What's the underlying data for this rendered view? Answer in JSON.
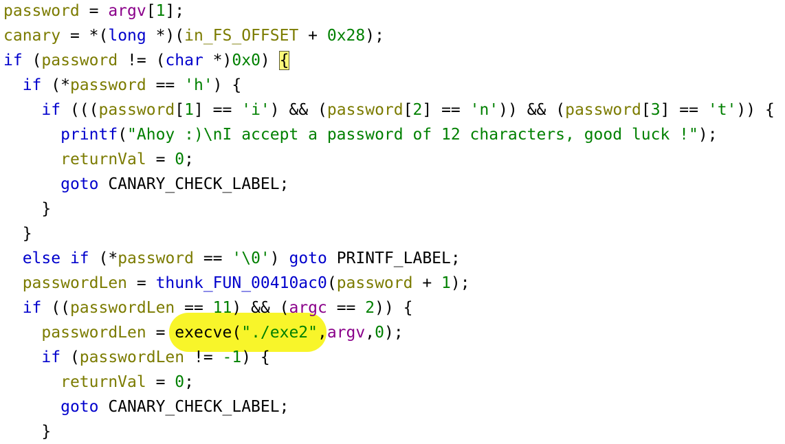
{
  "colors": {
    "variable": "#7b7b00",
    "keyword": "#0000cc",
    "number": "#008000",
    "string": "#008000",
    "type": "#0000cc",
    "function": "#0000cc",
    "parameter": "#8a008a",
    "plain": "#000000",
    "highlight": "#f8f52a",
    "brace_box": "#fbf97a"
  },
  "code": {
    "lines": [
      [
        {
          "t": "password",
          "c": "var"
        },
        {
          "t": " = ",
          "c": "plain"
        },
        {
          "t": "argv",
          "c": "param"
        },
        {
          "t": "[",
          "c": "plain"
        },
        {
          "t": "1",
          "c": "num"
        },
        {
          "t": "];",
          "c": "plain"
        }
      ],
      [
        {
          "t": "canary",
          "c": "var"
        },
        {
          "t": " = *(",
          "c": "plain"
        },
        {
          "t": "long",
          "c": "type"
        },
        {
          "t": " *)(",
          "c": "plain"
        },
        {
          "t": "in_FS_OFFSET",
          "c": "var"
        },
        {
          "t": " + ",
          "c": "plain"
        },
        {
          "t": "0x28",
          "c": "num"
        },
        {
          "t": ");",
          "c": "plain"
        }
      ],
      [
        {
          "t": "if",
          "c": "kw"
        },
        {
          "t": " (",
          "c": "plain"
        },
        {
          "t": "password",
          "c": "var"
        },
        {
          "t": " != (",
          "c": "plain"
        },
        {
          "t": "char",
          "c": "type"
        },
        {
          "t": " *)",
          "c": "plain"
        },
        {
          "t": "0x0",
          "c": "num"
        },
        {
          "t": ") ",
          "c": "plain"
        },
        {
          "t": "{",
          "c": "brace"
        }
      ],
      [
        {
          "t": "  ",
          "c": "plain"
        },
        {
          "t": "if",
          "c": "kw"
        },
        {
          "t": " (*",
          "c": "plain"
        },
        {
          "t": "password",
          "c": "var"
        },
        {
          "t": " == ",
          "c": "plain"
        },
        {
          "t": "'h'",
          "c": "str"
        },
        {
          "t": ") {",
          "c": "plain"
        }
      ],
      [
        {
          "t": "    ",
          "c": "plain"
        },
        {
          "t": "if",
          "c": "kw"
        },
        {
          "t": " (((",
          "c": "plain"
        },
        {
          "t": "password",
          "c": "var"
        },
        {
          "t": "[",
          "c": "plain"
        },
        {
          "t": "1",
          "c": "num"
        },
        {
          "t": "] == ",
          "c": "plain"
        },
        {
          "t": "'i'",
          "c": "str"
        },
        {
          "t": ") && (",
          "c": "plain"
        },
        {
          "t": "password",
          "c": "var"
        },
        {
          "t": "[",
          "c": "plain"
        },
        {
          "t": "2",
          "c": "num"
        },
        {
          "t": "] == ",
          "c": "plain"
        },
        {
          "t": "'n'",
          "c": "str"
        },
        {
          "t": ")) && (",
          "c": "plain"
        },
        {
          "t": "password",
          "c": "var"
        },
        {
          "t": "[",
          "c": "plain"
        },
        {
          "t": "3",
          "c": "num"
        },
        {
          "t": "] == ",
          "c": "plain"
        },
        {
          "t": "'t'",
          "c": "str"
        },
        {
          "t": ")) {",
          "c": "plain"
        }
      ],
      [
        {
          "t": "      ",
          "c": "plain"
        },
        {
          "t": "printf",
          "c": "fn"
        },
        {
          "t": "(",
          "c": "plain"
        },
        {
          "t": "\"Ahoy :)\\nI accept a password of 12 characters, good luck !\"",
          "c": "str"
        },
        {
          "t": ");",
          "c": "plain"
        }
      ],
      [
        {
          "t": "      ",
          "c": "plain"
        },
        {
          "t": "returnVal",
          "c": "var"
        },
        {
          "t": " = ",
          "c": "plain"
        },
        {
          "t": "0",
          "c": "num"
        },
        {
          "t": ";",
          "c": "plain"
        }
      ],
      [
        {
          "t": "      ",
          "c": "plain"
        },
        {
          "t": "goto",
          "c": "kw"
        },
        {
          "t": " CANARY_CHECK_LABEL;",
          "c": "plain"
        }
      ],
      [
        {
          "t": "    }",
          "c": "plain"
        }
      ],
      [
        {
          "t": "  }",
          "c": "plain"
        }
      ],
      [
        {
          "t": "  ",
          "c": "plain"
        },
        {
          "t": "else",
          "c": "kw"
        },
        {
          "t": " ",
          "c": "plain"
        },
        {
          "t": "if",
          "c": "kw"
        },
        {
          "t": " (*",
          "c": "plain"
        },
        {
          "t": "password",
          "c": "var"
        },
        {
          "t": " == ",
          "c": "plain"
        },
        {
          "t": "'\\0'",
          "c": "str"
        },
        {
          "t": ") ",
          "c": "plain"
        },
        {
          "t": "goto",
          "c": "kw"
        },
        {
          "t": " PRINTF_LABEL;",
          "c": "plain"
        }
      ],
      [
        {
          "t": "  ",
          "c": "plain"
        },
        {
          "t": "passwordLen",
          "c": "var"
        },
        {
          "t": " = ",
          "c": "plain"
        },
        {
          "t": "thunk_FUN_00410ac0",
          "c": "fn"
        },
        {
          "t": "(",
          "c": "plain"
        },
        {
          "t": "password",
          "c": "var"
        },
        {
          "t": " + ",
          "c": "plain"
        },
        {
          "t": "1",
          "c": "num"
        },
        {
          "t": ");",
          "c": "plain"
        }
      ],
      [
        {
          "t": "  ",
          "c": "plain"
        },
        {
          "t": "if",
          "c": "kw"
        },
        {
          "t": " ((",
          "c": "plain"
        },
        {
          "t": "passwordLen",
          "c": "var"
        },
        {
          "t": " == ",
          "c": "plain"
        },
        {
          "t": "11",
          "c": "num"
        },
        {
          "t": ") && (",
          "c": "plain"
        },
        {
          "t": "argc",
          "c": "param"
        },
        {
          "t": " == ",
          "c": "plain"
        },
        {
          "t": "2",
          "c": "num"
        },
        {
          "t": ")) {",
          "c": "plain"
        }
      ],
      [
        {
          "t": "    ",
          "c": "plain"
        },
        {
          "t": "passwordLen",
          "c": "var"
        },
        {
          "t": " = ",
          "c": "plain"
        },
        {
          "t": "execve",
          "c": "plain"
        },
        {
          "t": "(",
          "c": "plain"
        },
        {
          "t": "\"./exe2\"",
          "c": "str"
        },
        {
          "t": ",",
          "c": "plain"
        },
        {
          "t": "argv",
          "c": "param"
        },
        {
          "t": ",",
          "c": "plain"
        },
        {
          "t": "0",
          "c": "num"
        },
        {
          "t": ");",
          "c": "plain"
        }
      ],
      [
        {
          "t": "    ",
          "c": "plain"
        },
        {
          "t": "if",
          "c": "kw"
        },
        {
          "t": " (",
          "c": "plain"
        },
        {
          "t": "passwordLen",
          "c": "var"
        },
        {
          "t": " != ",
          "c": "plain"
        },
        {
          "t": "-1",
          "c": "num"
        },
        {
          "t": ") {",
          "c": "plain"
        }
      ],
      [
        {
          "t": "      ",
          "c": "plain"
        },
        {
          "t": "returnVal",
          "c": "var"
        },
        {
          "t": " = ",
          "c": "plain"
        },
        {
          "t": "0",
          "c": "num"
        },
        {
          "t": ";",
          "c": "plain"
        }
      ],
      [
        {
          "t": "      ",
          "c": "plain"
        },
        {
          "t": "goto",
          "c": "kw"
        },
        {
          "t": " CANARY_CHECK_LABEL;",
          "c": "plain"
        }
      ],
      [
        {
          "t": "    }",
          "c": "plain"
        }
      ]
    ]
  }
}
